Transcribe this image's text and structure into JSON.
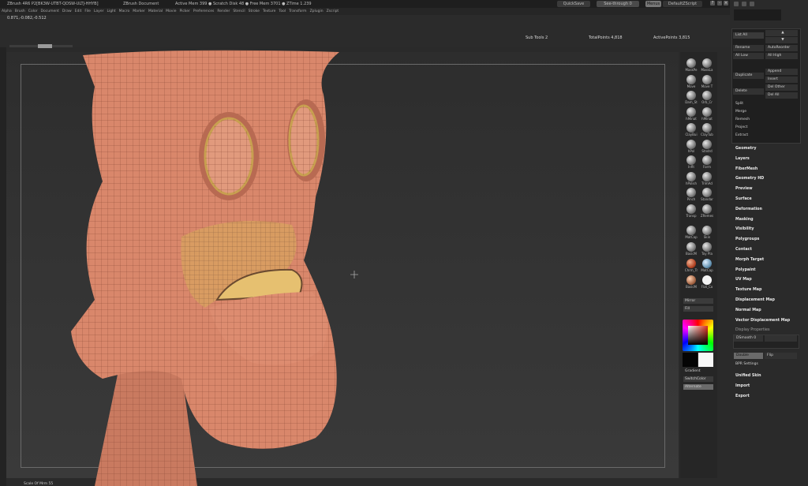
{
  "titlebar": {
    "app": "ZBrush 4R6 P2[BK3W-UTBT-QDSW-ULTJ-HHYB]",
    "document": "ZBrush Document",
    "memory": "Active Mem 399 ● Scratch Disk 48 ● Free Mem 3701 ● ZTime 1.239",
    "quicksave": "QuickSave",
    "seethrough": "See-through 0",
    "menus": "Menus",
    "script": "DefaultZScript"
  },
  "menubar": {
    "items": [
      "Alpha",
      "Brush",
      "Color",
      "Document",
      "Draw",
      "Edit",
      "File",
      "Layer",
      "Light",
      "Macro",
      "Marker",
      "Material",
      "Movie",
      "Picker",
      "Preferences",
      "Render",
      "Stencil",
      "Stroke",
      "Texture",
      "Tool",
      "Transform",
      "Zplugin",
      "Zscript"
    ]
  },
  "info": {
    "coords": "0.871,-0.082,-0.512",
    "subtools": "Sub Tools 2",
    "totalpoints": "TotalPoints 4,818",
    "activepoints": "ActivePoints 3,815"
  },
  "brushes": [
    "MaskPe",
    "MaskLa",
    "Move",
    "Move T",
    "Dam_St",
    "Orb_Cr",
    "hMinat",
    "hMinat",
    "ClayBui",
    "ClayTub",
    "hPol",
    "Stndrd",
    "Inflt",
    "Form",
    "hPolish",
    "TrimAd",
    "Pinch",
    "Standar",
    "Transp",
    "ZRemes"
  ],
  "materials": [
    "MatCap",
    "Skin",
    "BasicM",
    "Toy Pla",
    "Chrm_Tr",
    "MatCap",
    "BasicM",
    "Flat_Co"
  ],
  "tray_buttons": {
    "mirror": "Mirror",
    "fill": "Fill",
    "gradient": "Gradient",
    "switchcolor": "SwitchColor",
    "alternate": "Alternate"
  },
  "colors": {
    "skin": "#d9876b",
    "accent": "#f0a030"
  },
  "subtool_panel": {
    "list_all": "List All",
    "rename": "Rename",
    "autoreorder": "AutoReorder",
    "all_low": "All Low",
    "all_high": "All High",
    "duplicate": "Duplicate",
    "append": "Append",
    "insert": "Insert",
    "delete": "Delete",
    "del_other": "Del Other",
    "del_all": "Del All",
    "split": "Split",
    "merge": "Merge",
    "remesh": "Remesh",
    "project": "Project",
    "extract": "Extract"
  },
  "tool_menu": [
    "Geometry",
    "Layers",
    "FiberMesh",
    "Geometry HD",
    "Preview",
    "Surface",
    "Deformation",
    "Masking",
    "Visibility",
    "Polygroups",
    "Contact",
    "Morph Target",
    "Polypaint",
    "UV Map",
    "Texture Map",
    "Displacement Map",
    "Normal Map",
    "Vector Displacement Map",
    "Display Properties"
  ],
  "display_props": {
    "dsmooth": "DSmooth 0",
    "bpr": "BPR Settings",
    "double": "Double",
    "flip": "Flip"
  },
  "bottom_menu": [
    "Unified Skin",
    "Import",
    "Export"
  ],
  "statusbar": "Scale Of Mrm 55"
}
